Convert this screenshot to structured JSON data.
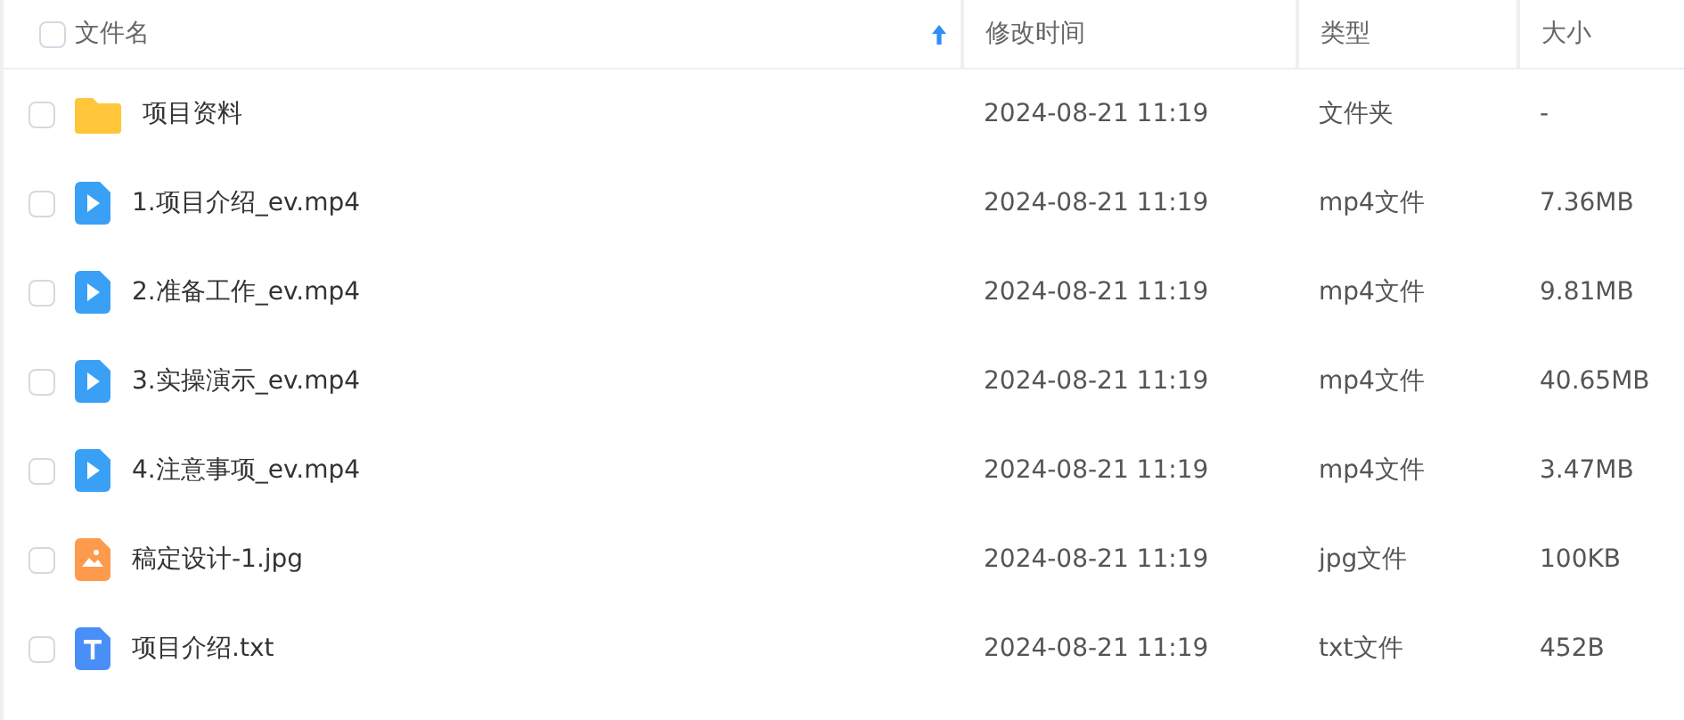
{
  "table": {
    "select_all": {
      "checked": false
    },
    "columns": [
      {
        "label": "文件名",
        "sorted": true
      },
      {
        "label": "修改时间",
        "sorted": false
      },
      {
        "label": "类型",
        "sorted": false
      },
      {
        "label": "大小",
        "sorted": false
      }
    ],
    "rows": [
      {
        "kind": "folder",
        "checked": false,
        "name": "项目资料",
        "modified": "2024-08-21 11:19",
        "type": "文件夹",
        "size": "-"
      },
      {
        "kind": "video",
        "checked": false,
        "name": "1.项目介绍_ev.mp4",
        "modified": "2024-08-21 11:19",
        "type": "mp4文件",
        "size": "7.36MB"
      },
      {
        "kind": "video",
        "checked": false,
        "name": "2.准备工作_ev.mp4",
        "modified": "2024-08-21 11:19",
        "type": "mp4文件",
        "size": "9.81MB"
      },
      {
        "kind": "video",
        "checked": false,
        "name": "3.实操演示_ev.mp4",
        "modified": "2024-08-21 11:19",
        "type": "mp4文件",
        "size": "40.65MB"
      },
      {
        "kind": "video",
        "checked": false,
        "name": "4.注意事项_ev.mp4",
        "modified": "2024-08-21 11:19",
        "type": "mp4文件",
        "size": "3.47MB"
      },
      {
        "kind": "image",
        "checked": false,
        "name": "稿定设计-1.jpg",
        "modified": "2024-08-21 11:19",
        "type": "jpg文件",
        "size": "100KB"
      },
      {
        "kind": "text",
        "checked": false,
        "name": "项目介绍.txt",
        "modified": "2024-08-21 11:19",
        "type": "txt文件",
        "size": "452B"
      }
    ]
  }
}
